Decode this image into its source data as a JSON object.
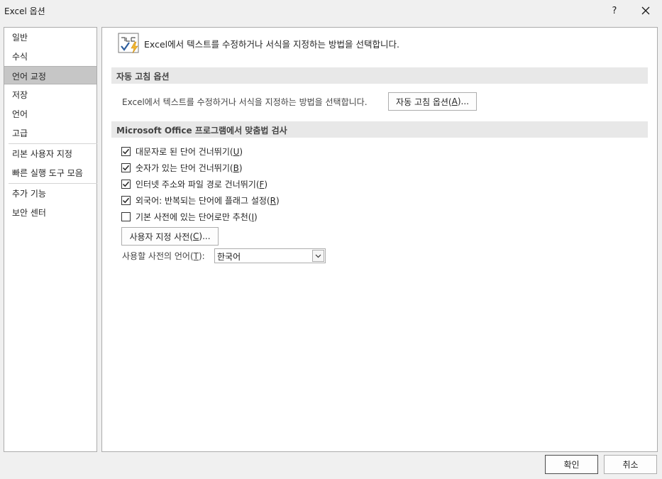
{
  "window": {
    "title": "Excel 옵션",
    "help_label": "?",
    "close_icon": "close-icon"
  },
  "nav": {
    "items": [
      {
        "label": "일반",
        "selected": false
      },
      {
        "label": "수식",
        "selected": false
      },
      {
        "label": "언어 교정",
        "selected": true
      },
      {
        "label": "저장",
        "selected": false
      },
      {
        "label": "언어",
        "selected": false
      },
      {
        "label": "고급",
        "selected": false
      },
      {
        "label": "리본 사용자 지정",
        "selected": false
      },
      {
        "label": "빠른 실행 도구 모음",
        "selected": false
      },
      {
        "label": "추가 기능",
        "selected": false
      },
      {
        "label": "보안 센터",
        "selected": false
      }
    ]
  },
  "header": {
    "icon": "proofing-abc-check-icon",
    "text": "Excel에서 텍스트를 수정하거나 서식을 지정하는 방법을 선택합니다."
  },
  "autocorrect": {
    "section_title": "자동 고침 옵션",
    "description": "Excel에서 텍스트를 수정하거나 서식을 지정하는 방법을 선택합니다.",
    "button_pre": "자동 고침 옵션(",
    "button_key": "A",
    "button_post": ")..."
  },
  "spelling": {
    "section_title": "Microsoft Office 프로그램에서 맞춤법 검사",
    "options": [
      {
        "pre": "대문자로 된 단어 건너뛰기(",
        "key": "U",
        "post": ")",
        "checked": true
      },
      {
        "pre": "숫자가 있는 단어 건너뛰기(",
        "key": "B",
        "post": ")",
        "checked": true
      },
      {
        "pre": "인터넷 주소와 파일 경로 건너뛰기(",
        "key": "F",
        "post": ")",
        "checked": true
      },
      {
        "pre": "외국어: 반복되는 단어에 플래그 설정(",
        "key": "R",
        "post": ")",
        "checked": true
      },
      {
        "pre": "기본 사전에 있는 단어로만 추천(",
        "key": "I",
        "post": ")",
        "checked": false
      }
    ],
    "custom_dict_pre": "사용자 지정 사전(",
    "custom_dict_key": "C",
    "custom_dict_post": ")...",
    "language_label_pre": "사용할 사전의 언어(",
    "language_label_key": "T",
    "language_label_post": "):",
    "language_value": "한국어"
  },
  "footer": {
    "ok_label": "확인",
    "cancel_label": "취소"
  }
}
